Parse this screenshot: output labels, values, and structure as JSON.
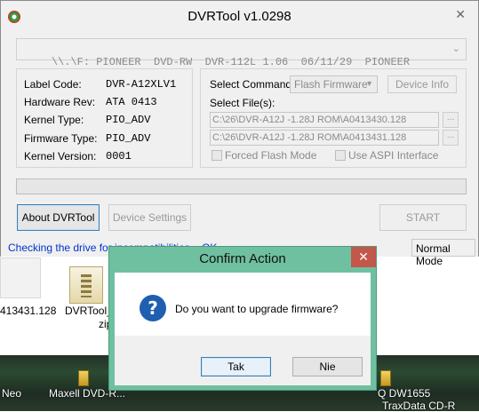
{
  "window": {
    "title": "DVRTool v1.0298",
    "close_glyph": "✕"
  },
  "drive_selector": {
    "value": "\\\\.\\F: PIONEER  DVD-RW  DVR-112L 1.06  06/11/29  PIONEER",
    "arrow": "⌄"
  },
  "drive_info": [
    {
      "label": "Label Code:",
      "value": "DVR-A12XLV1"
    },
    {
      "label": "Hardware Rev:",
      "value": "ATA 0413"
    },
    {
      "label": "Kernel Type:",
      "value": "PIO_ADV"
    },
    {
      "label": "Firmware Type:",
      "value": "PIO_ADV"
    },
    {
      "label": "Kernel Version:",
      "value": "0001"
    }
  ],
  "command": {
    "select_label": "Select Command:",
    "select_value": "Flash Firmware",
    "device_info_button": "Device Info",
    "files_label": "Select File(s):",
    "file1": "C:\\26\\DVR-A12J -1.28J ROM\\A0413430.128",
    "file2": "C:\\26\\DVR-A12J -1.28J ROM\\A0413431.128",
    "browse_label": "...",
    "forced_flash_label": "Forced Flash Mode",
    "aspi_label": "Use ASPI Interface"
  },
  "buttons": {
    "about": "About DVRTool",
    "device_settings": "Device Settings",
    "start": "START"
  },
  "status": {
    "text": "Checking the drive for incompatibilities... OK",
    "mode": "Normal Mode"
  },
  "desktop": {
    "label_left_file": "413431.128",
    "label_dvrtool": "DVRTool_",
    "label_dvrtool_2": "zip",
    "taskbar_labels": [
      "Neo",
      "Maxell DVD-R...",
      "Q DW1655",
      "TraxData CD-R"
    ]
  },
  "dialog": {
    "title": "Confirm Action",
    "close_glyph": "✕",
    "icon_glyph": "?",
    "message": "Do you want to upgrade firmware?",
    "yes": "Tak",
    "no": "Nie"
  }
}
